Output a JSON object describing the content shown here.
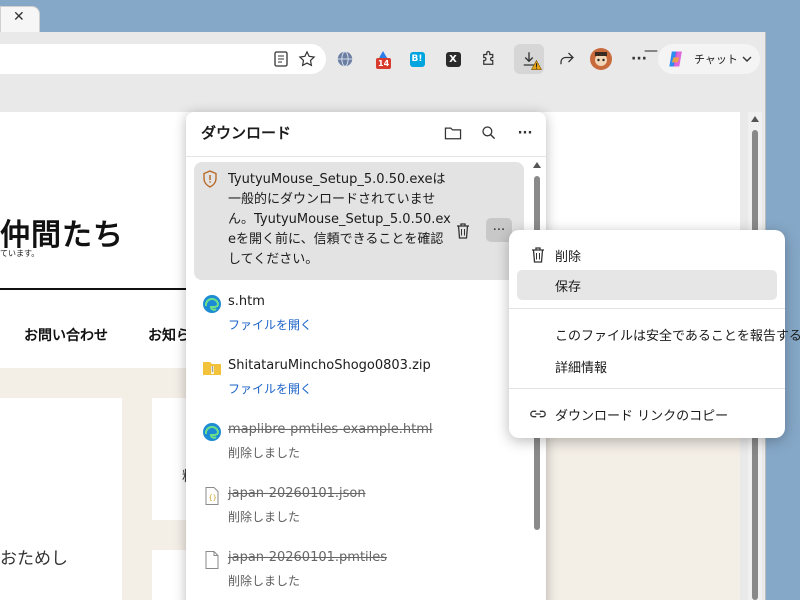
{
  "window": {
    "bg_tab_close": "✕",
    "minimize": "—",
    "maximize": "☐",
    "close": "✕"
  },
  "toolbar": {
    "badge_count": "14",
    "hatena_label": "B!",
    "x_label": "X",
    "more_label": "···",
    "copilot_label": "チャット"
  },
  "page": {
    "title": "仲間たち",
    "subtitle": "ています。",
    "nav": [
      "お問い合わせ",
      "お知ら"
    ],
    "body_text": "おためし",
    "card_char": "料"
  },
  "panel": {
    "title": "ダウンロード",
    "warning": {
      "text": "TyutyuMouse_Setup_5.0.50.exeは一般的にダウンロードされていません。TyutyuMouse_Setup_5.0.50.exeを開く前に、信頼できることを確認してください。",
      "more": "···"
    },
    "items": [
      {
        "name": "s.htm",
        "sub": "ファイルを開く",
        "icon": "edge-icon",
        "deleted": false
      },
      {
        "name": "ShitataruMinchoShogo0803.zip",
        "sub": "ファイルを開く",
        "icon": "zip-folder-icon",
        "deleted": false
      },
      {
        "name": "maplibre-pmtiles-example.html",
        "sub": "削除しました",
        "icon": "edge-icon",
        "deleted": true
      },
      {
        "name": "japan-20260101.json",
        "sub": "削除しました",
        "icon": "json-file-icon",
        "deleted": true
      },
      {
        "name": "japan-20260101.pmtiles",
        "sub": "削除しました",
        "icon": "file-icon",
        "deleted": true
      }
    ]
  },
  "menu": {
    "delete": "削除",
    "save": "保存",
    "report_safe": "このファイルは安全であることを報告する",
    "details": "詳細情報",
    "copy_link": "ダウンロード リンクのコピー"
  },
  "colors": {
    "accent_link": "#1d63c9",
    "warning_bg": "#e3e3e3",
    "desktop": "#86a8c8"
  }
}
